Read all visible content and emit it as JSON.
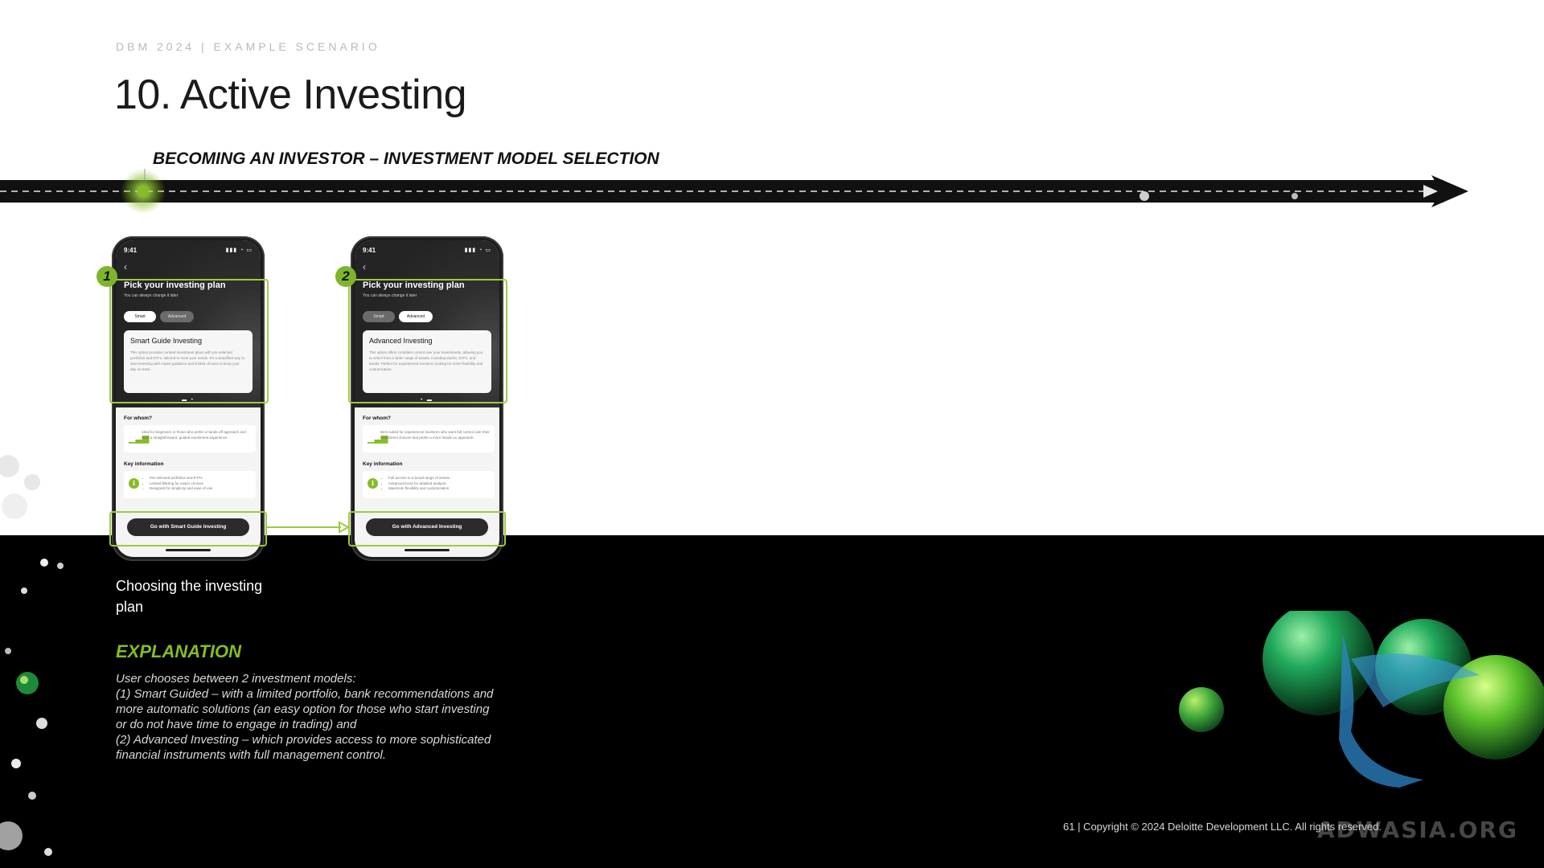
{
  "slide": {
    "eyebrow": "DBM 2024 | EXAMPLE SCENARIO",
    "title": "10. Active Investing",
    "section_heading": "BECOMING AN INVESTOR – INVESTMENT MODEL SELECTION",
    "accent_color": "#86BC25"
  },
  "phones": [
    {
      "badge": "1",
      "status_time": "9:41",
      "status_icons": "▮▮▮ ◔ ▭",
      "back_icon": "chevron-left-icon",
      "plan_title": "Pick your investing plan",
      "plan_subtitle": "You can always change it later",
      "toggle_smart": "Smart",
      "toggle_advanced": "Advanced",
      "active_toggle": "Smart",
      "card_title": "Smart Guide Investing",
      "card_desc": "This option provides curated investment plans with pre-selected portfolios and ETFs, tailored to meet your needs. It's a simplified way to start investing with expert guidance and limited choices to keep your day on track.",
      "dots": "▬ •",
      "for_whom_label": "For whom?",
      "for_whom_text": "Ideal for beginners or those who prefer a hands-off approach and want a straightforward, guided investment experience.",
      "key_info_label": "Key information",
      "key_info_items": [
        "Pre-selected portfolios and ETFs",
        "Limited filtering for easier choices",
        "Designed for simplicity and ease of use"
      ],
      "cta": "Go with Smart Guide Investing"
    },
    {
      "badge": "2",
      "status_time": "9:41",
      "status_icons": "▮▮▮ ◔ ▭",
      "back_icon": "chevron-left-icon",
      "plan_title": "Pick your investing plan",
      "plan_subtitle": "You can always change it later",
      "toggle_smart": "Smart",
      "toggle_advanced": "Advanced",
      "active_toggle": "Advanced",
      "card_title": "Advanced Investing",
      "card_desc": "This option offers complete control over your investments, allowing you to select from a wider range of assets, including stocks, ETFs, and bonds. Perfect for experienced investors looking for more flexibility and customization.",
      "dots": "• ▬",
      "for_whom_label": "For whom?",
      "for_whom_text": "Best suited for experienced investors who want full control over their investment choices and prefer a more hands-on approach.",
      "key_info_label": "Key information",
      "key_info_items": [
        "Full access to a broad range of assets",
        "Advanced tools for detailed analysis",
        "Maximum flexibility and customization"
      ],
      "cta": "Go with Advanced Investing"
    }
  ],
  "caption": "Choosing the investing plan",
  "explanation": {
    "heading": "EXPLANATION",
    "intro": "User chooses between 2 investment models:",
    "point_1": "(1) Smart Guided – with a limited portfolio, bank recommendations and more automatic solutions (an easy option for those who start investing or do not have time to engage in trading) and",
    "point_2": "(2) Advanced Investing – which provides access to more sophisticated financial instruments with full management control."
  },
  "footer": {
    "text": "61 | Copyright © 2024 Deloitte Development LLC. All rights reserved.",
    "watermark": "ADWASIA.ORG"
  }
}
